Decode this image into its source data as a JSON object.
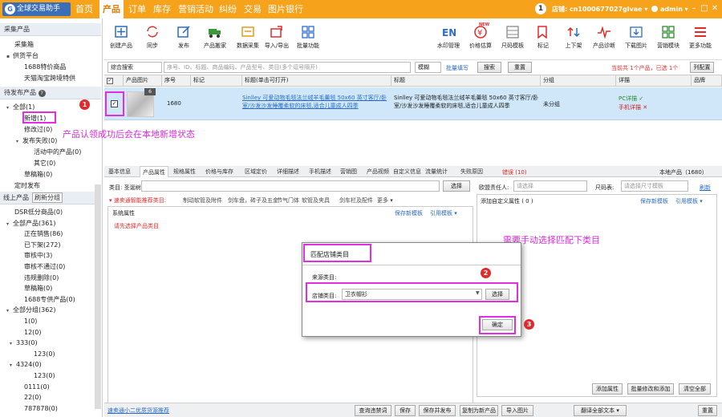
{
  "app": {
    "title": "全球交易助手",
    "logo_letter": "G"
  },
  "nav": [
    {
      "label": "首页",
      "active": false
    },
    {
      "label": "产品",
      "active": true
    },
    {
      "label": "订单",
      "active": false
    },
    {
      "label": "库存",
      "active": false
    },
    {
      "label": "营销活动",
      "active": false
    },
    {
      "label": "纠纷",
      "active": false
    },
    {
      "label": "交易",
      "active": false
    },
    {
      "label": "图片银行",
      "active": false
    }
  ],
  "header": {
    "badge": "1",
    "store_label": "店铺: cn1000677027glvae ▾",
    "user": "admin ▾",
    "win_min": "–",
    "win_max": "□",
    "win_close": "✕"
  },
  "sidebar": {
    "section1": "采集产品",
    "collect": "采集箱",
    "supply": "供货平台",
    "supply_child1": "1688特价商品",
    "supply_child2": "天猫淘宝跨境特供",
    "section2": "待发布产品",
    "help_icon": "?",
    "all": "全部(1)",
    "new": "新增(1)",
    "modified": "修改过(0)",
    "publish_failed": "发布失败(0)",
    "active_products": "活动中的产品(0)",
    "other": "其它(0)",
    "draft": "草稿箱(0)",
    "timed": "定时发布",
    "online_tab": "线上产品",
    "refresh_group": "刷新分组",
    "online_items": [
      "DSR低分商品(0)",
      "全部产品(361)",
      "正在销售(86)",
      "已下架(272)",
      "审核中(3)",
      "审核不通过(0)",
      "违规删除(0)",
      "草稿箱(0)",
      "1688专供产品(0)",
      "全部分组(362)",
      "1(0)",
      "12(0)",
      "333(0)",
      "123(0)",
      "4324(0)",
      "123(0)",
      "0111(0)",
      "22(0)",
      "787878(0)"
    ]
  },
  "toolbar": {
    "tools": [
      "创建产品",
      "同步",
      "发布",
      "产品搬家",
      "数据采集",
      "导入/导出",
      "批量功能",
      "水印管理",
      "价格估算",
      "尺码模板",
      "标记",
      "上下架",
      "产品诊断",
      "下载图片",
      "营销模块",
      "更多功能"
    ],
    "new_badge": "NEW"
  },
  "filter": {
    "search_type": "综合搜索",
    "placeholder": "序号、ID、标题、商品编码、产品型号、类目(多个逗号隔开)",
    "mode": "模糊",
    "batch": "批量填写",
    "search": "搜索",
    "reset": "重置",
    "page_info": "当前共 1个产品，已选 1个",
    "col_config": "列配置"
  },
  "table": {
    "headers": [
      "产品图片",
      "序号",
      "标记",
      "标题(单击可打开)",
      "标题",
      "分组",
      "详描",
      "品牌"
    ],
    "row": {
      "img_count": "6",
      "seq": "1680",
      "title_link": "Sinlley 可爱动物毛毯法兰绒羊毛羹毯 50x60 英寸客厅/卧室/沙发沙发睡覆柔软的床毯,适合儿童成人四季",
      "title_plain": "Sinlley 可爱动物毛毯法兰绒羊毛羹毯 50x60 英寸客厅/卧室/沙发沙发睡覆柔软的床毯,适合儿童成人四季",
      "group": "未分组",
      "detail_pc": "PC详描 ✓",
      "detail_mobile": "手机详描 ✕"
    }
  },
  "annotations": {
    "status_note": "产品认领成功后会在本地新增状态",
    "category_note": "需要手动选择匹配下类目",
    "n1": "1",
    "n2": "2",
    "n3": "3"
  },
  "detail_tabs": {
    "tabs": [
      "基本信息",
      "产品属性",
      "规格属性",
      "价格与库存",
      "区域定价",
      "详细描述",
      "手机描述",
      "营销图",
      "产品视频",
      "自定义信息",
      "流量统计",
      "失败原因"
    ],
    "error_label": "错误 (10)",
    "local_products": "本地产品（1680）"
  },
  "attr": {
    "category_label": "类目: 圣诞树",
    "select_btn": "选择",
    "recommend": "▾ 速卖通智能推荐类目:",
    "rec_items": [
      "制动软管及附件",
      "剑车盘，砖子及五金",
      "节气门体",
      "软管及夹具",
      "剑车栏及配件",
      "更多 ▾"
    ],
    "sys_attr": "系统属性",
    "save_tpl": "保存新模板",
    "quote_tpl": "引用模板 ▾",
    "pick_cat_first": "请先选择产品类目",
    "mix_label": "欧盟责任人:",
    "mix_ph": "请选择",
    "size_label": "尺码表:",
    "size_ph": "请选择尺寸模板",
    "refresh_link": "刷新",
    "add_custom": "添加自定义属性 ( 0 )",
    "save_tpl2": "保存新模板",
    "quote_tpl2": "引用模板 ▾",
    "add_attr": "添加属性",
    "batch_add": "批量修改和添加",
    "clear_all": "清空全部"
  },
  "modal": {
    "title": "匹配店铺类目",
    "source_label": "来源类目:",
    "store_label": "店铺类目:",
    "store_value": "卫衣帽衫",
    "select": "选择",
    "confirm": "确定"
  },
  "statusbar": {
    "link": "速卖通小二优质货源推荐",
    "buttons": [
      "查询违禁词",
      "保存",
      "保存并发布",
      "复制为新产品",
      "导入图片",
      "翻译全部文本 ▾",
      "重置"
    ]
  },
  "colors": {
    "accent": "#f7a21b",
    "link": "#2b6cc4",
    "highlight": "#d92ad9",
    "marker": "#e12b2b"
  }
}
